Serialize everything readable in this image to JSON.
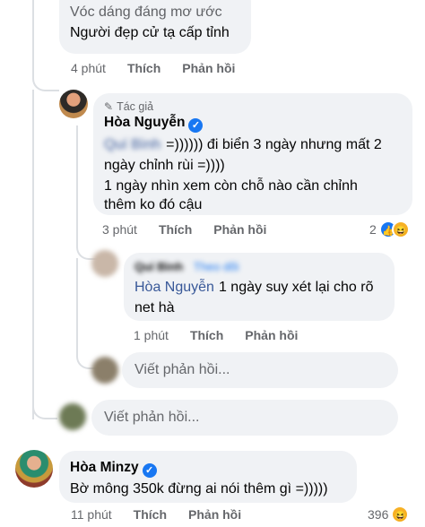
{
  "comment_top": {
    "line1": "Vóc dáng đáng mơ ước",
    "line2": "Người đẹp cử tạ cấp tỉnh",
    "time": "4 phút",
    "like": "Thích",
    "reply": "Phản hồi"
  },
  "comment_author": {
    "author_badge": "Tác giả",
    "name": "Hòa Nguyễn",
    "tagged_user": "Quí Bình",
    "line1": "=)))))) đi biển 3 ngày nhưng mất 2",
    "line2": "ngày chỉnh rùi =))))",
    "line3": "1 ngày nhìn xem còn chỗ nào cần chỉnh",
    "line4": "thêm ko đó cậu",
    "time": "3 phút",
    "like": "Thích",
    "reply": "Phản hồi",
    "reaction_count": "2"
  },
  "comment_reply": {
    "name": "Quí Bình",
    "follow": "Theo dõi",
    "mention": "Hòa Nguyễn",
    "text1": "1 ngày suy xét lại cho rõ",
    "text2": "net hà",
    "time": "1 phút",
    "like": "Thích",
    "reply": "Phản hồi"
  },
  "reply_input_inner": {
    "placeholder": "Viết phản hồi..."
  },
  "reply_input_outer": {
    "placeholder": "Viết phản hồi..."
  },
  "comment_minzy": {
    "name": "Hòa Minzy",
    "text": "Bờ mông 350k đừng ai nói thêm gì =)))))",
    "time": "11 phút",
    "like": "Thích",
    "reply": "Phản hồi",
    "reaction_count": "396"
  },
  "colors": {
    "bubble": "#f0f2f5",
    "meta_gray": "#65676b",
    "verified_blue": "#1877f2",
    "mention_blue": "#385898"
  }
}
